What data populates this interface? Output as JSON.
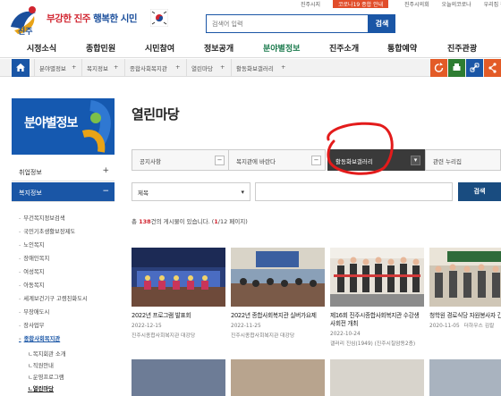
{
  "header": {
    "slogan_red": "부강한 진주",
    "slogan_blue": "행복한",
    "slogan_end": "시민",
    "search_placeholder": "검색어 입력",
    "search_button": "검색",
    "utility_links": [
      "진주시지",
      "코로나19 종합 안내",
      "진주시의회",
      "오늘의코로나",
      "우리집 찾기"
    ]
  },
  "gnb": {
    "items": [
      "시정소식",
      "종합민원",
      "시민참여",
      "정보공개",
      "분야별정보",
      "진주소개",
      "통합예약",
      "진주관광"
    ],
    "active": "분야별정보"
  },
  "breadcrumb": {
    "items": [
      "분야별정보",
      "복지정보",
      "종합사회복지관",
      "열린마당",
      "활동화보갤러리"
    ]
  },
  "sidebar": {
    "banner": "분야별정보",
    "menus": [
      {
        "label": "취업정보",
        "active": false
      },
      {
        "label": "복지정보",
        "active": true
      }
    ],
    "sub_items": [
      "부건복지정보검색",
      "국민기초생활보장제도",
      "노인복지",
      "장애인복지",
      "여성복지",
      "아동복지",
      "세계보건기구 고령친화도시",
      "무장애도시",
      "장사업무",
      "종합사회복지관"
    ],
    "current_sub": "종합사회복지관",
    "sub_sub_items": [
      "복지회관 소개",
      "직원안내",
      "운영프로그램",
      "열린마당"
    ],
    "current_sub_sub": "열린마당"
  },
  "main": {
    "title": "열린마당",
    "tabs": [
      "공지사항",
      "복지관에 바란다",
      "활동화보갤러리",
      "관련 누리집"
    ],
    "active_tab": "활동화보갤러리",
    "filter_select": "제목",
    "filter_button": "검색",
    "count_prefix": "총",
    "count_total": "138",
    "count_mid": "건의 게시물이 있습니다. (",
    "count_page": "1",
    "count_suffix": "/12 페이지)"
  },
  "gallery": [
    {
      "title": "2022년 프로그램 발표회",
      "date": "2022-12-15",
      "author": "진주시종합사회복지관 대강당"
    },
    {
      "title": "2022년 종합사회복지관 실버가요제",
      "date": "2022-11-25",
      "author": "진주시종합사회복지관 대강당"
    },
    {
      "title": "제16회 진주시종합사회복지관 수강생 사회전 개최",
      "date": "2022-10-24",
      "author": "갤러리 진심(1949) (진주시칠암동2층)"
    },
    {
      "title": "청학원 경로식당 자원봉사자 간담회",
      "date": "2020-11-05",
      "author": "더하우스 김칼"
    }
  ],
  "colors": {
    "brand_blue": "#1a56a6",
    "active_green": "#1a7a4c",
    "slogan_red": "#d1242f",
    "active_tab": "#3a3a3a"
  }
}
